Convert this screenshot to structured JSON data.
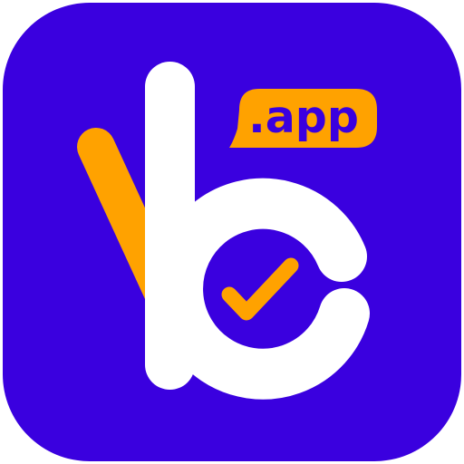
{
  "app_icon": {
    "badge_text": ".app",
    "colors": {
      "background": "#3A00DF",
      "letter": "#FFFFFF",
      "accent": "#FFA200",
      "page": "#FFFFFF"
    },
    "icons": [
      "b-letter-logo",
      "check-mark-icon"
    ]
  }
}
